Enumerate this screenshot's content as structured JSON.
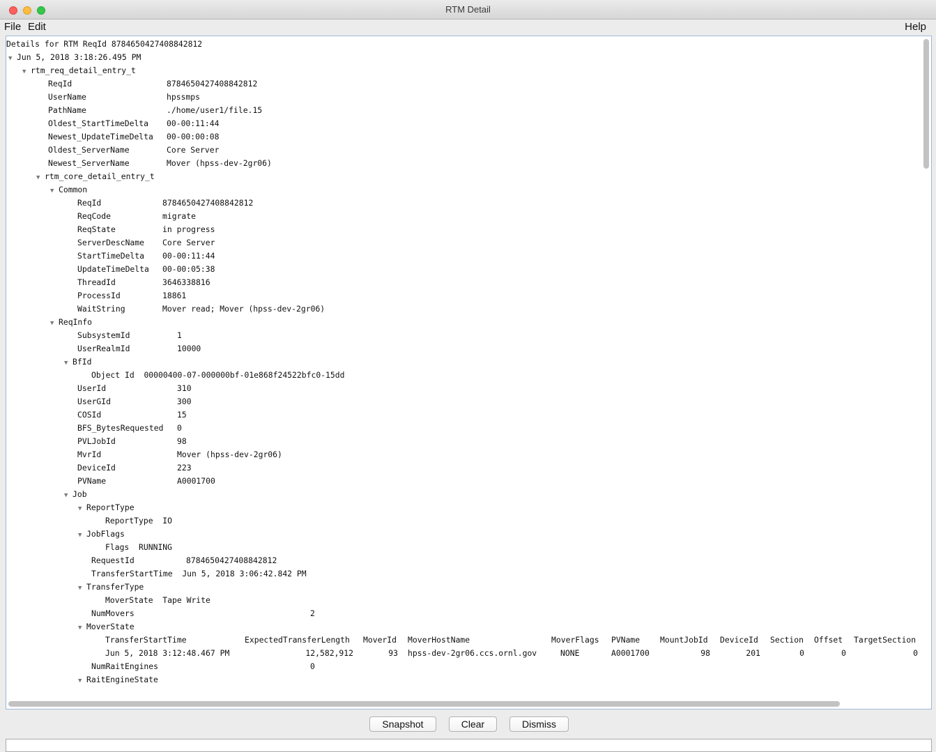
{
  "window": {
    "title": "RTM Detail"
  },
  "menu": {
    "file": "File",
    "edit": "Edit",
    "help": "Help"
  },
  "tree": {
    "header": "Details for RTM ReqId 8784650427408842812",
    "timestamp": "Jun 5, 2018 3:18:26.495 PM",
    "req_entry": "rtm_req_detail_entry_t",
    "req_fields": [
      {
        "k": "ReqId",
        "v": "8784650427408842812"
      },
      {
        "k": "UserName",
        "v": "hpssmps"
      },
      {
        "k": "PathName",
        "v": "./home/user1/file.15"
      },
      {
        "k": "Oldest_StartTimeDelta",
        "v": "00-00:11:44"
      },
      {
        "k": "Newest_UpdateTimeDelta",
        "v": "00-00:00:08"
      },
      {
        "k": "Oldest_ServerName",
        "v": "Core Server"
      },
      {
        "k": "Newest_ServerName",
        "v": "Mover (hpss-dev-2gr06)"
      }
    ],
    "core_entry": "rtm_core_detail_entry_t",
    "common": "Common",
    "common_fields": [
      {
        "k": "ReqId",
        "v": "8784650427408842812"
      },
      {
        "k": "ReqCode",
        "v": "migrate"
      },
      {
        "k": "ReqState",
        "v": "in progress"
      },
      {
        "k": "ServerDescName",
        "v": "Core Server"
      },
      {
        "k": "StartTimeDelta",
        "v": "00-00:11:44"
      },
      {
        "k": "UpdateTimeDelta",
        "v": "00-00:05:38"
      },
      {
        "k": "ThreadId",
        "v": "3646338816"
      },
      {
        "k": "ProcessId",
        "v": "18861"
      },
      {
        "k": "WaitString",
        "v": "Mover read; Mover (hpss-dev-2gr06)"
      }
    ],
    "reqinfo": "ReqInfo",
    "reqinfo_fields_a": [
      {
        "k": "SubsystemId",
        "v": "1"
      },
      {
        "k": "UserRealmId",
        "v": "10000"
      }
    ],
    "bfid": "BfId",
    "bfid_object": {
      "k": "Object Id",
      "v": "00000400-07-000000bf-01e868f24522bfc0-15dd"
    },
    "reqinfo_fields_b": [
      {
        "k": "UserId",
        "v": "310"
      },
      {
        "k": "UserGId",
        "v": "300"
      },
      {
        "k": "COSId",
        "v": "15"
      },
      {
        "k": "BFS_BytesRequested",
        "v": "0"
      },
      {
        "k": "PVLJobId",
        "v": "98"
      },
      {
        "k": "MvrId",
        "v": "Mover (hpss-dev-2gr06)"
      },
      {
        "k": "DeviceId",
        "v": "223"
      },
      {
        "k": "PVName",
        "v": "A0001700"
      }
    ],
    "job": "Job",
    "reporttype": "ReportType",
    "reporttype_field": {
      "k": "ReportType",
      "v": "IO"
    },
    "jobflags": "JobFlags",
    "jobflags_field": {
      "k": "Flags",
      "v": "RUNNING"
    },
    "requestid": {
      "k": "RequestId",
      "v": "8784650427408842812"
    },
    "transferstarttime": {
      "k": "TransferStartTime",
      "v": "Jun 5, 2018 3:06:42.842 PM"
    },
    "transfertype": "TransferType",
    "transfertype_field": {
      "k": "MoverState",
      "v": "Tape Write"
    },
    "nummovers": {
      "k": "NumMovers",
      "v": "2"
    },
    "moverstate": "MoverState",
    "mover_table": {
      "headers": [
        "TransferStartTime",
        "ExpectedTransferLength",
        "MoverId",
        "MoverHostName",
        "MoverFlags",
        "PVName",
        "MountJobId",
        "DeviceId",
        "Section",
        "Offset",
        "TargetSection"
      ],
      "row": [
        "Jun 5, 2018 3:12:48.467 PM",
        "12,582,912",
        "93",
        "hpss-dev-2gr06.ccs.ornl.gov",
        "NONE",
        "A0001700",
        "98",
        "201",
        "0",
        "0",
        "0"
      ]
    },
    "numraitengines": {
      "k": "NumRaitEngines",
      "v": "0"
    },
    "raitenginestate": "RaitEngineState"
  },
  "buttons": {
    "snapshot": "Snapshot",
    "clear": "Clear",
    "dismiss": "Dismiss"
  }
}
